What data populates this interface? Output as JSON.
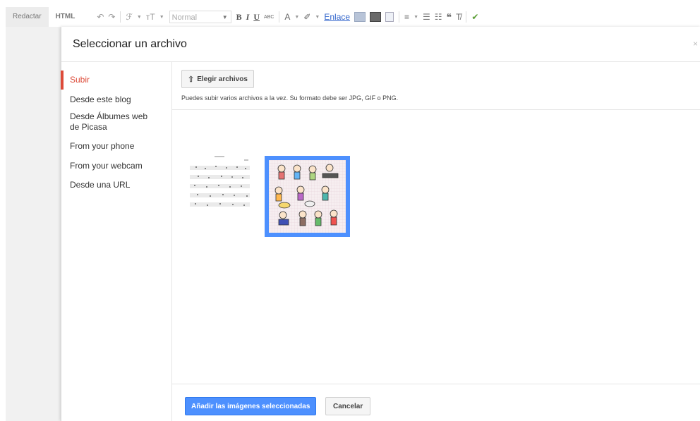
{
  "toolbar": {
    "compose_tab": "Redactar",
    "html_tab": "HTML",
    "undo_icon": "undo-icon",
    "redo_icon": "redo-icon",
    "font_family_glyph": "ℱ",
    "font_size_glyph": "ᴛT",
    "font_select_value": "Normal",
    "bold": "B",
    "italic": "I",
    "underline": "U",
    "strike": "ABC",
    "text_color_glyph": "A",
    "highlight_glyph": "✐",
    "link_label": "Enlace",
    "quote_glyph": "❝",
    "remove_format_glyph": "T̸",
    "spellcheck_glyph": "✔"
  },
  "dialog": {
    "title": "Seleccionar un archivo",
    "close_glyph": "×",
    "sidebar": {
      "items": [
        {
          "label": "Subir",
          "active": true
        },
        {
          "label": "Desde este blog"
        },
        {
          "label": "Desde Álbumes web de Picasa"
        },
        {
          "label": "From your phone"
        },
        {
          "label": "From your webcam"
        },
        {
          "label": "Desde una URL"
        }
      ]
    },
    "choose_button_label": "Elegir archivos",
    "help_text": "Puedes subir varios archivos a la vez. Su formato debe ser JPG, GIF o PNG.",
    "thumbnails": [
      {
        "icon": "sheet-music-thumbnail"
      },
      {
        "icon": "musicians-clipart-thumbnail",
        "selected": true
      }
    ],
    "add_button_label": "Añadir las imágenes seleccionadas",
    "cancel_button_label": "Cancelar"
  },
  "colors": {
    "accent_red": "#dd4b39",
    "primary_blue": "#4d90fe",
    "selection_border": "#4d90fe"
  }
}
